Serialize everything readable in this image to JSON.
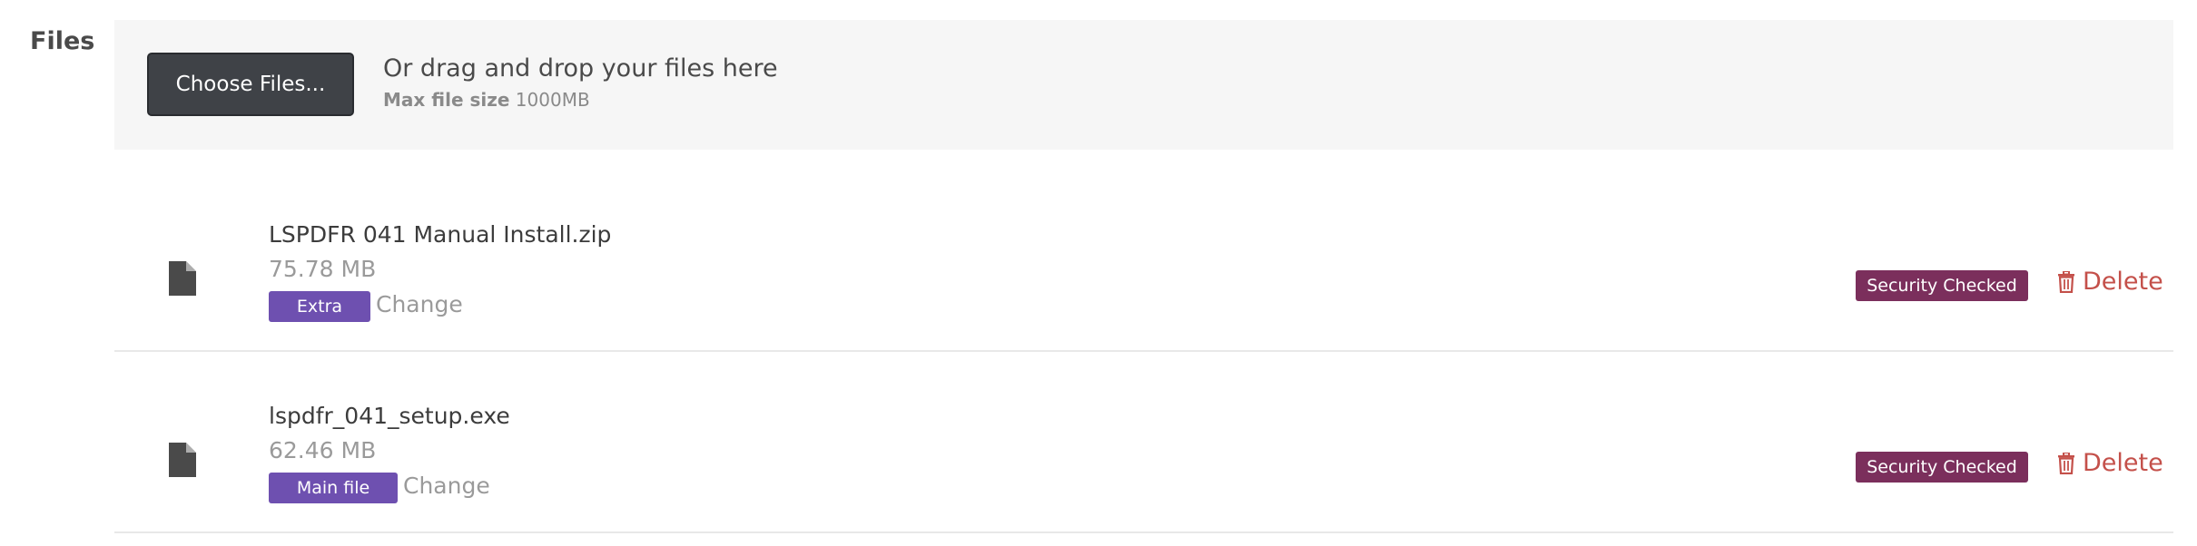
{
  "section_label": "Files",
  "dropzone": {
    "button_label": "Choose Files...",
    "drop_text": "Or drag and drop your files here",
    "max_size_label": "Max file size",
    "max_size_value": "1000MB"
  },
  "files": [
    {
      "name": "LSPDFR 041 Manual Install.zip",
      "size": "75.78 MB",
      "type_label": "Extra",
      "change_label": "Change",
      "security_label": "Security Checked",
      "delete_label": "Delete"
    },
    {
      "name": "lspdfr_041_setup.exe",
      "size": "62.46 MB",
      "type_label": "Main file",
      "change_label": "Change",
      "security_label": "Security Checked",
      "delete_label": "Delete"
    }
  ],
  "colors": {
    "button_bg": "#3f4247",
    "type_badge": "#6e50b0",
    "security_badge": "#7b2f5c",
    "delete": "#c4504a"
  },
  "icons": {
    "file": "file-icon",
    "trash": "trash-icon"
  }
}
